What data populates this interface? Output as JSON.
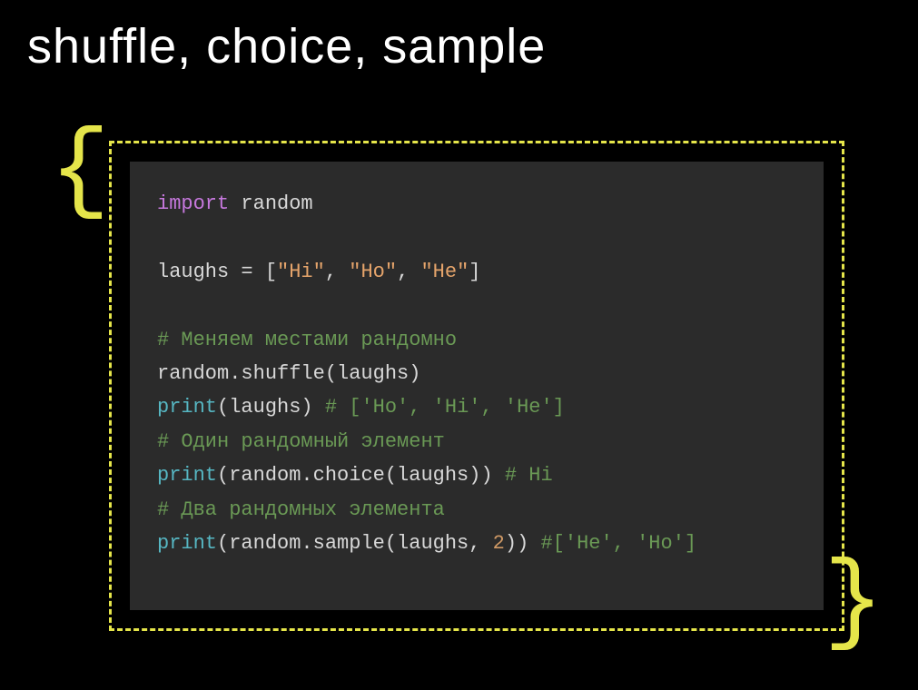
{
  "title": "shuffle, choice, sample",
  "braces": {
    "left": "{",
    "right": "}"
  },
  "code": {
    "line1": {
      "import": "import",
      "module": " random"
    },
    "line2": {
      "var": "laughs ",
      "eq": "= ",
      "br_open": "[",
      "s1": "\"Hi\"",
      "c1": ", ",
      "s2": "\"Ho\"",
      "c2": ", ",
      "s3": "\"He\"",
      "br_close": "]"
    },
    "comment1": "# Меняем местами рандомно",
    "line3": "random.shuffle(laughs)",
    "line4": {
      "print": "print",
      "args": "(laughs) ",
      "cmt": "# ['Ho', 'Hi', 'He']"
    },
    "comment2": "# Один рандомный элемент",
    "line5": {
      "print": "print",
      "args": "(random.choice(laughs)) ",
      "cmt": "# Hi"
    },
    "comment3": "# Два рандомных элемента",
    "line6": {
      "print": "print",
      "args_a": "(random.sample(laughs, ",
      "num": "2",
      "args_b": ")) ",
      "cmt": "#['He', 'Ho']"
    }
  }
}
